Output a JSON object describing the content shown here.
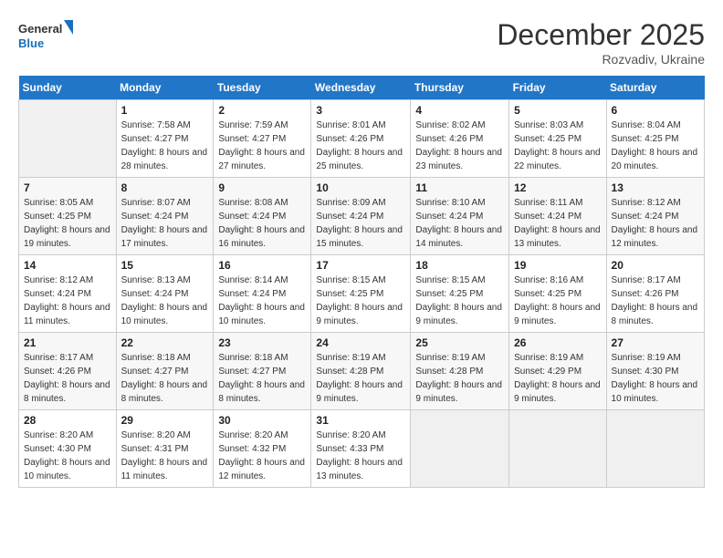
{
  "header": {
    "logo_line1": "General",
    "logo_line2": "Blue",
    "month_year": "December 2025",
    "location": "Rozvadiv, Ukraine"
  },
  "calendar": {
    "days_of_week": [
      "Sunday",
      "Monday",
      "Tuesday",
      "Wednesday",
      "Thursday",
      "Friday",
      "Saturday"
    ],
    "weeks": [
      [
        {
          "day": "",
          "sunrise": "",
          "sunset": "",
          "daylight": ""
        },
        {
          "day": "1",
          "sunrise": "Sunrise: 7:58 AM",
          "sunset": "Sunset: 4:27 PM",
          "daylight": "Daylight: 8 hours and 28 minutes."
        },
        {
          "day": "2",
          "sunrise": "Sunrise: 7:59 AM",
          "sunset": "Sunset: 4:27 PM",
          "daylight": "Daylight: 8 hours and 27 minutes."
        },
        {
          "day": "3",
          "sunrise": "Sunrise: 8:01 AM",
          "sunset": "Sunset: 4:26 PM",
          "daylight": "Daylight: 8 hours and 25 minutes."
        },
        {
          "day": "4",
          "sunrise": "Sunrise: 8:02 AM",
          "sunset": "Sunset: 4:26 PM",
          "daylight": "Daylight: 8 hours and 23 minutes."
        },
        {
          "day": "5",
          "sunrise": "Sunrise: 8:03 AM",
          "sunset": "Sunset: 4:25 PM",
          "daylight": "Daylight: 8 hours and 22 minutes."
        },
        {
          "day": "6",
          "sunrise": "Sunrise: 8:04 AM",
          "sunset": "Sunset: 4:25 PM",
          "daylight": "Daylight: 8 hours and 20 minutes."
        }
      ],
      [
        {
          "day": "7",
          "sunrise": "Sunrise: 8:05 AM",
          "sunset": "Sunset: 4:25 PM",
          "daylight": "Daylight: 8 hours and 19 minutes."
        },
        {
          "day": "8",
          "sunrise": "Sunrise: 8:07 AM",
          "sunset": "Sunset: 4:24 PM",
          "daylight": "Daylight: 8 hours and 17 minutes."
        },
        {
          "day": "9",
          "sunrise": "Sunrise: 8:08 AM",
          "sunset": "Sunset: 4:24 PM",
          "daylight": "Daylight: 8 hours and 16 minutes."
        },
        {
          "day": "10",
          "sunrise": "Sunrise: 8:09 AM",
          "sunset": "Sunset: 4:24 PM",
          "daylight": "Daylight: 8 hours and 15 minutes."
        },
        {
          "day": "11",
          "sunrise": "Sunrise: 8:10 AM",
          "sunset": "Sunset: 4:24 PM",
          "daylight": "Daylight: 8 hours and 14 minutes."
        },
        {
          "day": "12",
          "sunrise": "Sunrise: 8:11 AM",
          "sunset": "Sunset: 4:24 PM",
          "daylight": "Daylight: 8 hours and 13 minutes."
        },
        {
          "day": "13",
          "sunrise": "Sunrise: 8:12 AM",
          "sunset": "Sunset: 4:24 PM",
          "daylight": "Daylight: 8 hours and 12 minutes."
        }
      ],
      [
        {
          "day": "14",
          "sunrise": "Sunrise: 8:12 AM",
          "sunset": "Sunset: 4:24 PM",
          "daylight": "Daylight: 8 hours and 11 minutes."
        },
        {
          "day": "15",
          "sunrise": "Sunrise: 8:13 AM",
          "sunset": "Sunset: 4:24 PM",
          "daylight": "Daylight: 8 hours and 10 minutes."
        },
        {
          "day": "16",
          "sunrise": "Sunrise: 8:14 AM",
          "sunset": "Sunset: 4:24 PM",
          "daylight": "Daylight: 8 hours and 10 minutes."
        },
        {
          "day": "17",
          "sunrise": "Sunrise: 8:15 AM",
          "sunset": "Sunset: 4:25 PM",
          "daylight": "Daylight: 8 hours and 9 minutes."
        },
        {
          "day": "18",
          "sunrise": "Sunrise: 8:15 AM",
          "sunset": "Sunset: 4:25 PM",
          "daylight": "Daylight: 8 hours and 9 minutes."
        },
        {
          "day": "19",
          "sunrise": "Sunrise: 8:16 AM",
          "sunset": "Sunset: 4:25 PM",
          "daylight": "Daylight: 8 hours and 9 minutes."
        },
        {
          "day": "20",
          "sunrise": "Sunrise: 8:17 AM",
          "sunset": "Sunset: 4:26 PM",
          "daylight": "Daylight: 8 hours and 8 minutes."
        }
      ],
      [
        {
          "day": "21",
          "sunrise": "Sunrise: 8:17 AM",
          "sunset": "Sunset: 4:26 PM",
          "daylight": "Daylight: 8 hours and 8 minutes."
        },
        {
          "day": "22",
          "sunrise": "Sunrise: 8:18 AM",
          "sunset": "Sunset: 4:27 PM",
          "daylight": "Daylight: 8 hours and 8 minutes."
        },
        {
          "day": "23",
          "sunrise": "Sunrise: 8:18 AM",
          "sunset": "Sunset: 4:27 PM",
          "daylight": "Daylight: 8 hours and 8 minutes."
        },
        {
          "day": "24",
          "sunrise": "Sunrise: 8:19 AM",
          "sunset": "Sunset: 4:28 PM",
          "daylight": "Daylight: 8 hours and 9 minutes."
        },
        {
          "day": "25",
          "sunrise": "Sunrise: 8:19 AM",
          "sunset": "Sunset: 4:28 PM",
          "daylight": "Daylight: 8 hours and 9 minutes."
        },
        {
          "day": "26",
          "sunrise": "Sunrise: 8:19 AM",
          "sunset": "Sunset: 4:29 PM",
          "daylight": "Daylight: 8 hours and 9 minutes."
        },
        {
          "day": "27",
          "sunrise": "Sunrise: 8:19 AM",
          "sunset": "Sunset: 4:30 PM",
          "daylight": "Daylight: 8 hours and 10 minutes."
        }
      ],
      [
        {
          "day": "28",
          "sunrise": "Sunrise: 8:20 AM",
          "sunset": "Sunset: 4:30 PM",
          "daylight": "Daylight: 8 hours and 10 minutes."
        },
        {
          "day": "29",
          "sunrise": "Sunrise: 8:20 AM",
          "sunset": "Sunset: 4:31 PM",
          "daylight": "Daylight: 8 hours and 11 minutes."
        },
        {
          "day": "30",
          "sunrise": "Sunrise: 8:20 AM",
          "sunset": "Sunset: 4:32 PM",
          "daylight": "Daylight: 8 hours and 12 minutes."
        },
        {
          "day": "31",
          "sunrise": "Sunrise: 8:20 AM",
          "sunset": "Sunset: 4:33 PM",
          "daylight": "Daylight: 8 hours and 13 minutes."
        },
        {
          "day": "",
          "sunrise": "",
          "sunset": "",
          "daylight": ""
        },
        {
          "day": "",
          "sunrise": "",
          "sunset": "",
          "daylight": ""
        },
        {
          "day": "",
          "sunrise": "",
          "sunset": "",
          "daylight": ""
        }
      ]
    ]
  }
}
